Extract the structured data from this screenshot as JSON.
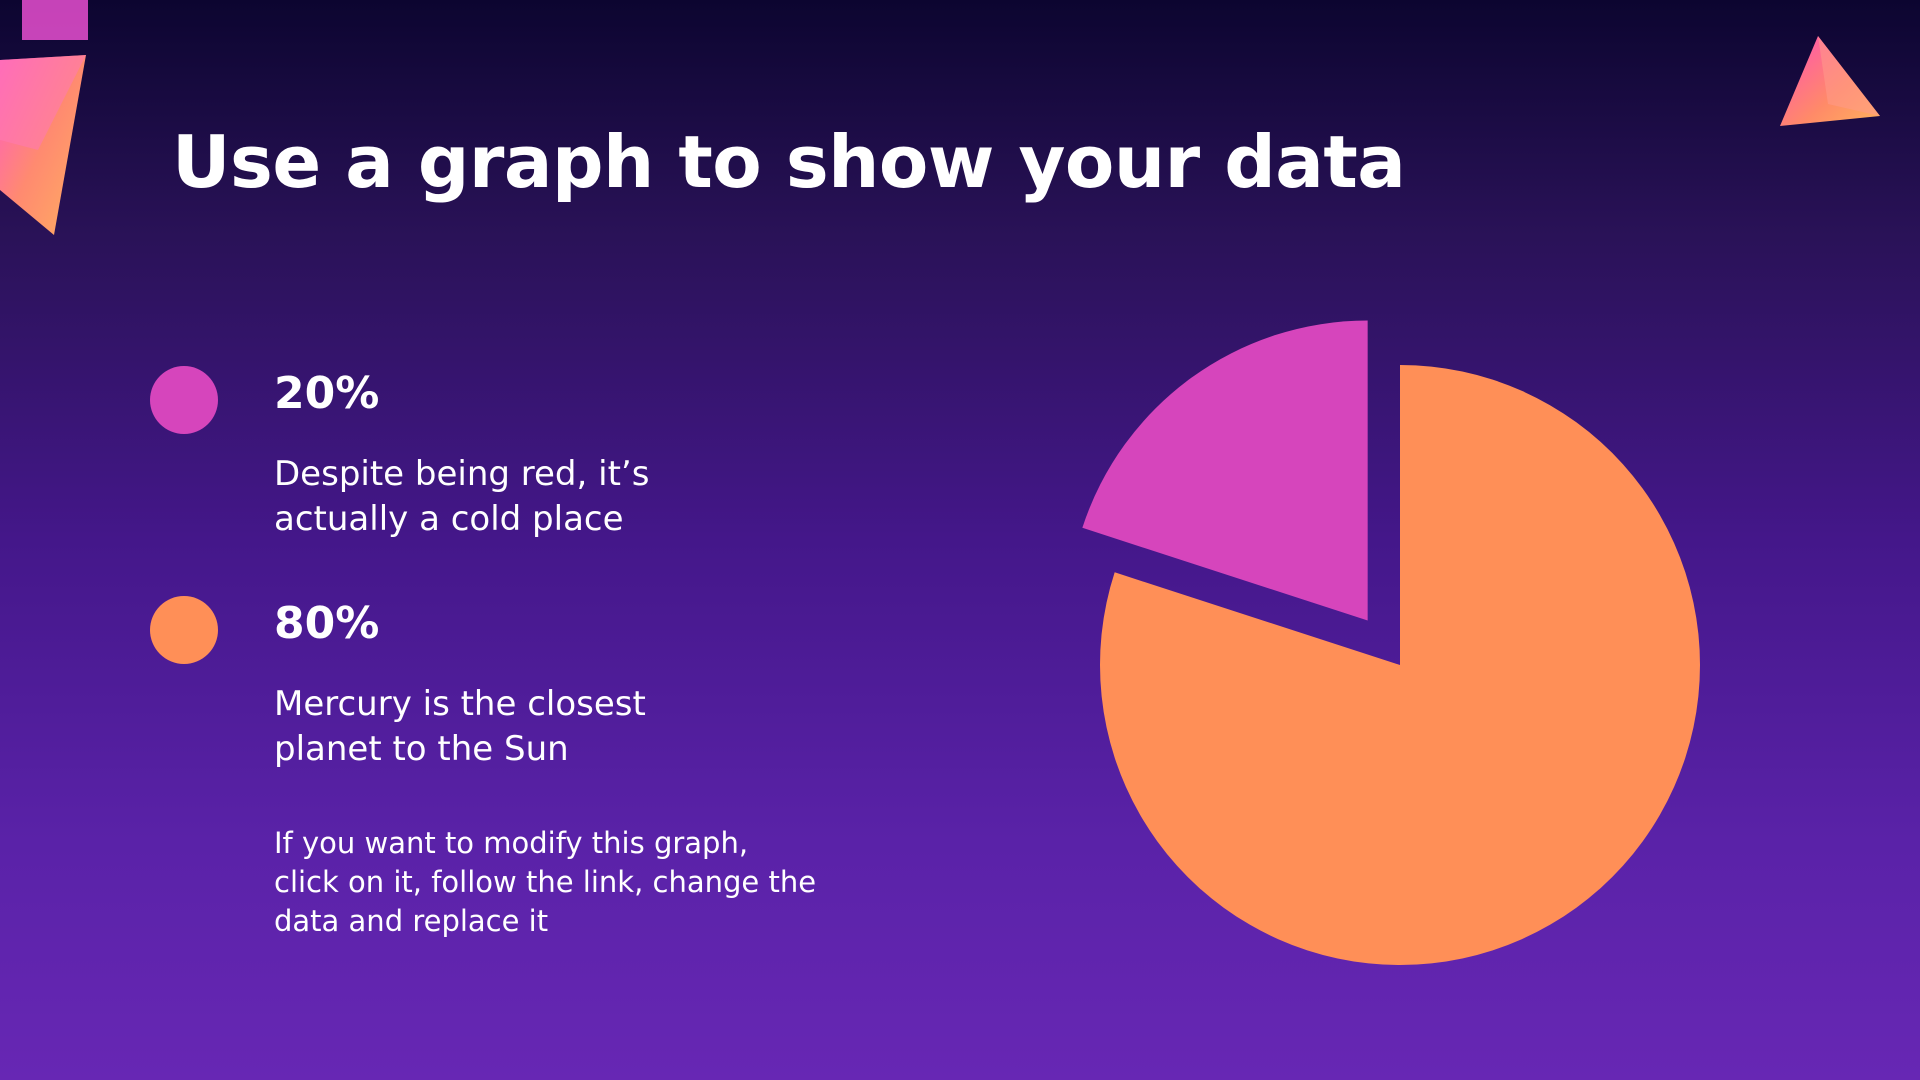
{
  "slide": {
    "title": "Use a graph to show your data",
    "note": "If you want to modify this graph,\nclick on it, follow the link, change the\ndata and replace it"
  },
  "legend": [
    {
      "value": "20%",
      "description": "Despite being red, it’s\nactually a cold place",
      "color": "#d645bc"
    },
    {
      "value": "80%",
      "description": "Mercury is the closest\nplanet to the Sun",
      "color": "#ff8f57"
    }
  ],
  "colors": {
    "background_top": "#0c0530",
    "background_bottom": "#6727b4",
    "accent_pink": "#d645bc",
    "accent_orange": "#ff8f57"
  },
  "decorations": [
    "gradient-triangle-top-left",
    "gradient-triangle-top-right"
  ],
  "chart_data": {
    "type": "pie",
    "categories": [
      "20%",
      "80%"
    ],
    "values": [
      20,
      80
    ],
    "colors": [
      "#d645bc",
      "#ff8f57"
    ],
    "exploded": [
      true,
      false
    ],
    "title": ""
  }
}
